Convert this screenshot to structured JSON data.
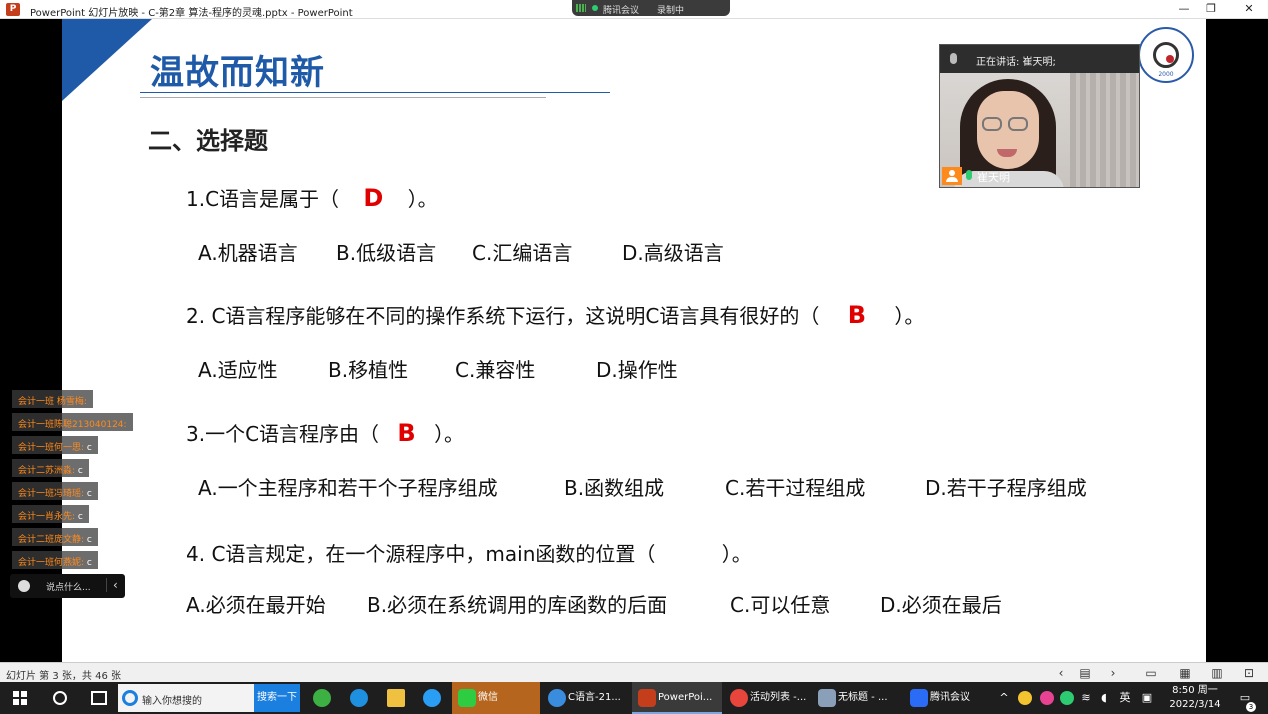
{
  "window": {
    "title": "PowerPoint 幻灯片放映  -  C-第2章 算法-程序的灵魂.pptx - PowerPoint",
    "app_icon": "P",
    "minimize": "—",
    "restore": "❐",
    "close": "✕"
  },
  "meeting_bar": {
    "app": "腾讯会议",
    "recording": "录制中"
  },
  "slide": {
    "title": "温故而知新",
    "section": "二、选择题",
    "questions": [
      {
        "prefix": "1.C语言是属于（",
        "answer": "D",
        "suffix": "）。",
        "options": [
          "A.机器语言",
          "B.低级语言",
          "C.汇编语言",
          "D.高级语言"
        ]
      },
      {
        "prefix": "2. C语言程序能够在不同的操作系统下运行，这说明C语言具有很好的（",
        "answer": "B",
        "suffix": "）。",
        "options": [
          "A.适应性",
          "B.移植性",
          "C.兼容性",
          "D.操作性"
        ]
      },
      {
        "prefix": "3.一个C语言程序由（",
        "answer": "B",
        "suffix": "）。",
        "options": [
          "A.一个主程序和若干个子程序组成",
          "B.函数组成",
          "C.若干过程组成",
          "D.若干子程序组成"
        ]
      },
      {
        "prefix": "4. C语言规定，在一个源程序中，main函数的位置（",
        "answer": "",
        "suffix": "）。",
        "options": [
          "A.必须在最开始",
          "B.必须在系统调用的库函数的后面",
          "C.可以任意",
          "D.必须在最后"
        ]
      }
    ],
    "logo_year": "2000"
  },
  "video": {
    "speaking_label": "正在讲话: 崔天明;",
    "participant_name": "崔天明"
  },
  "chat": {
    "messages": [
      {
        "sender": "会计一班  杨雪梅:",
        "text": ""
      },
      {
        "sender": "会计一班陈聪213040124:",
        "text": ""
      },
      {
        "sender": "会计一班何一思:",
        "text": "c"
      },
      {
        "sender": "会计二苏洲淼:",
        "text": "c"
      },
      {
        "sender": "会计一班冯琦瑶:",
        "text": "c"
      },
      {
        "sender": "会计一肖永先:",
        "text": "c"
      },
      {
        "sender": "会计二班庞文静:",
        "text": "c"
      },
      {
        "sender": "会计一班何燕妮:",
        "text": "c"
      }
    ],
    "input_placeholder": "说点什么..."
  },
  "statusbar": {
    "slide_info": "幻灯片 第 3 张，共 46 张"
  },
  "taskbar": {
    "search_placeholder": "输入你想搜的",
    "search_button": "搜索一下",
    "tasks": [
      "微信",
      "C语言-21...",
      "PowerPoi...",
      "活动列表 -...",
      "无标题 - ...",
      "腾讯会议"
    ],
    "ime": "英",
    "time": "8:50 周一",
    "date": "2022/3/14",
    "notification_count": "3"
  },
  "colors": {
    "title_blue": "#1f5aa8",
    "answer_red": "#e00000",
    "chat_sender": "#ff8a1c"
  }
}
